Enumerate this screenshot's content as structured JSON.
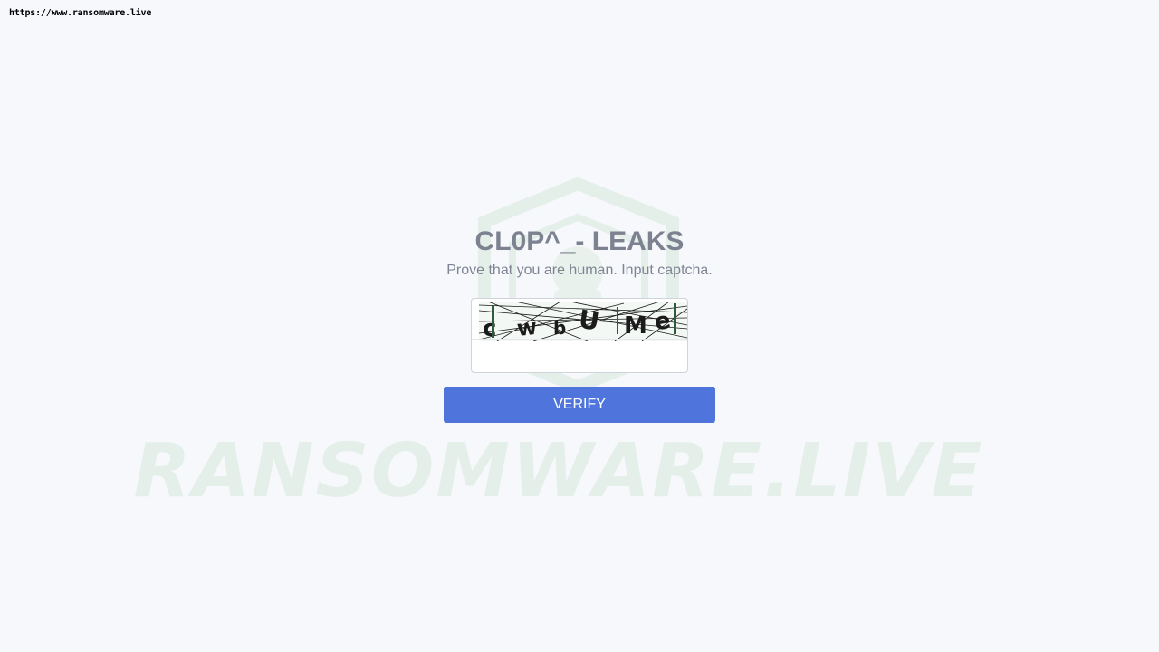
{
  "url_stamp": "https://www.ransomware.live",
  "watermark_text": "RANSOMWARE.LIVE",
  "title": "CL0P^_- LEAKS",
  "subtitle": "Prove that you are human. Input captcha.",
  "captcha": {
    "image_text": "cwbUMe",
    "input_value": "",
    "input_placeholder": ""
  },
  "verify_label": "VERIFY",
  "colors": {
    "background": "#f6f8fc",
    "button": "#4f75dd",
    "title": "#7c8290",
    "watermark": "#e5efe9"
  },
  "icons": [
    "ransomware-live-hexagon-logo"
  ]
}
